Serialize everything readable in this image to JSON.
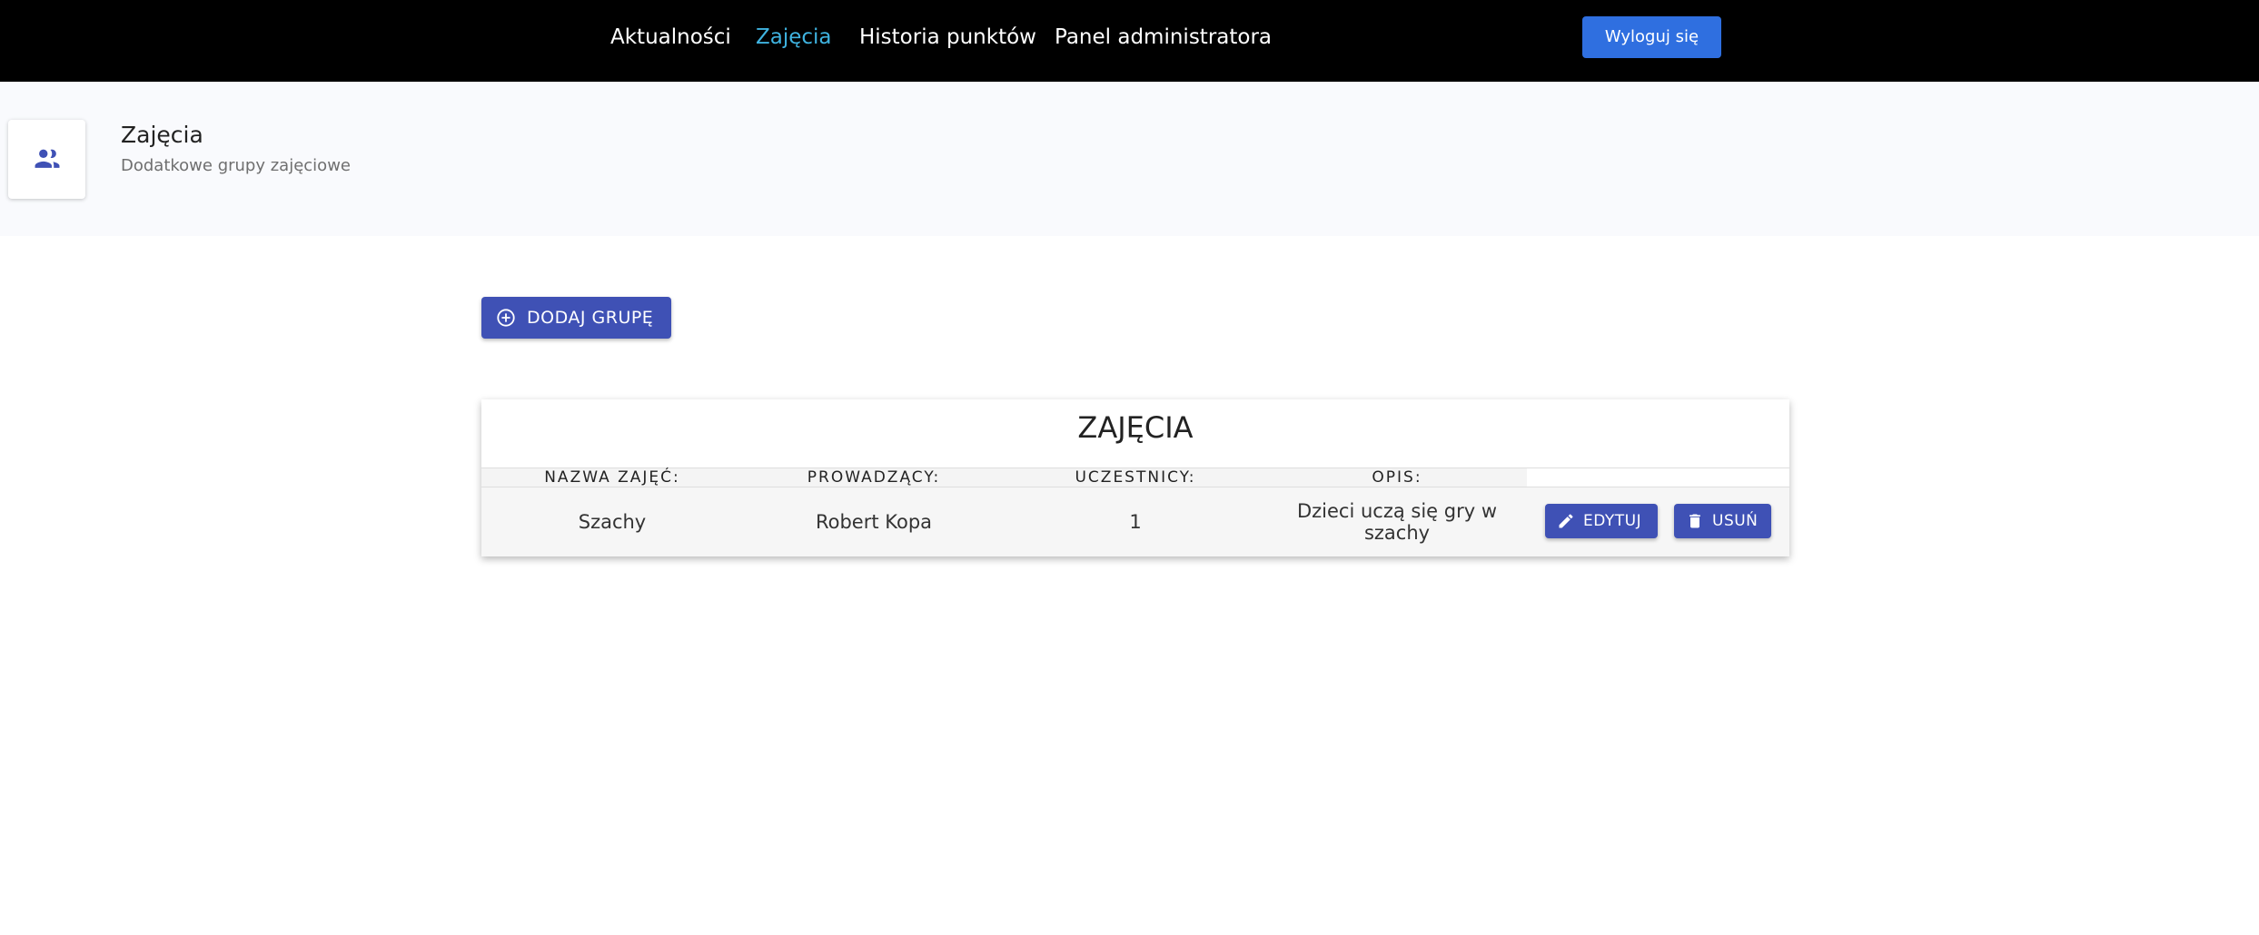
{
  "nav": {
    "items": [
      {
        "label": "Aktualności",
        "active": false
      },
      {
        "label": "Zajęcia",
        "active": true
      },
      {
        "label": "Historia punktów",
        "active": false
      },
      {
        "label": "Panel administratora",
        "active": false
      }
    ],
    "logout_label": "Wyloguj się"
  },
  "header": {
    "icon": "group-icon",
    "title": "Zajęcia",
    "subtitle": "Dodatkowe grupy zajęciowe"
  },
  "toolbar": {
    "add_label": "DODAJ GRUPĘ",
    "add_icon": "add-circle-icon"
  },
  "table": {
    "title": "ZAJĘCIA",
    "columns": [
      "NAZWA ZAJĘĆ:",
      "PROWADZĄCY:",
      "UCZESTNICY:",
      "OPIS:"
    ],
    "rows": [
      {
        "name": "Szachy",
        "teacher": "Robert Kopa",
        "participants": "1",
        "description": "Dzieci uczą się gry w szachy",
        "edit_label": "EDYTUJ",
        "delete_label": "USUŃ"
      }
    ]
  },
  "colors": {
    "nav_background": "#000000",
    "nav_active": "#3fb3e0",
    "logout_button": "#2f6fe0",
    "primary_button": "#3f51b5",
    "header_background": "#f9fafd"
  }
}
